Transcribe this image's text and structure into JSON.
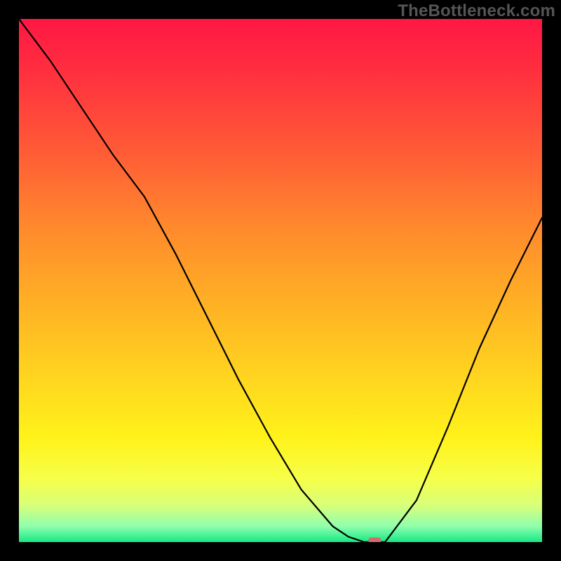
{
  "watermark": "TheBottleneck.com",
  "chart_data": {
    "type": "line",
    "title": "",
    "xlabel": "",
    "ylabel": "",
    "xlim": [
      0,
      100
    ],
    "ylim": [
      0,
      100
    ],
    "grid": false,
    "legend": false,
    "x": [
      0,
      6,
      12,
      18,
      24,
      30,
      36,
      42,
      48,
      54,
      60,
      63,
      66,
      70,
      76,
      82,
      88,
      94,
      100
    ],
    "values": [
      100,
      92,
      83,
      74,
      66,
      55,
      43,
      31,
      20,
      10,
      3,
      1,
      0,
      0,
      8,
      22,
      37,
      50,
      62
    ],
    "marker": {
      "x": 68,
      "y": 0
    },
    "gradient_stops": [
      {
        "offset": 0.0,
        "color": "#ff1744"
      },
      {
        "offset": 0.1,
        "color": "#ff2f3f"
      },
      {
        "offset": 0.25,
        "color": "#ff5a36"
      },
      {
        "offset": 0.4,
        "color": "#ff8a2d"
      },
      {
        "offset": 0.55,
        "color": "#ffb224"
      },
      {
        "offset": 0.7,
        "color": "#ffd91f"
      },
      {
        "offset": 0.8,
        "color": "#fff21a"
      },
      {
        "offset": 0.88,
        "color": "#f6ff4a"
      },
      {
        "offset": 0.93,
        "color": "#d8ff7a"
      },
      {
        "offset": 0.97,
        "color": "#8fffad"
      },
      {
        "offset": 1.0,
        "color": "#17e884"
      }
    ]
  }
}
